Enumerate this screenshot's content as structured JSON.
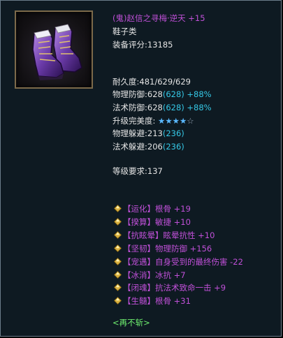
{
  "item": {
    "title": "(鬼)赵信之寻梅·逆天",
    "enhance": "+15",
    "type": "鞋子类",
    "score_label": "装备评分:",
    "score_value": "13185",
    "icon": "purple-boots-icon"
  },
  "stats": {
    "durability": "耐久度:481/629/629",
    "phys_def_label": "物理防御:628",
    "phys_def_extra": "(628) +88%",
    "mag_def_label": "法术防御:628",
    "mag_def_extra": "(628) +88%",
    "upgrade_label": "升级完美度:",
    "upgrade_stars_filled": "★★★★",
    "upgrade_stars_empty": "☆",
    "phys_dodge_label": "物理躲避:213",
    "phys_dodge_extra": "(236)",
    "mag_dodge_label": "法术躲避:206",
    "mag_dodge_extra": "(236)"
  },
  "requirement": "等级要求:137",
  "gems": [
    {
      "tag": "【运化】",
      "text": "根骨 +19"
    },
    {
      "tag": "【揆算】",
      "text": "敏捷 +10"
    },
    {
      "tag": "【抗眩晕】",
      "text": "眩晕抗性 +10"
    },
    {
      "tag": "【坚韧】",
      "text": "物理防御 +156"
    },
    {
      "tag": "【宠遇】",
      "text": "自身受到的最终伤害 -22"
    },
    {
      "tag": "【冰消】",
      "text": "冰抗 +7"
    },
    {
      "tag": "【闭魂】",
      "text": "抗法术致命一击 +9"
    },
    {
      "tag": "【生髓】",
      "text": "根骨 +31"
    }
  ],
  "footer": "<再不斩>",
  "colors": {
    "title": "#c050d8",
    "cyan": "#35c8e6",
    "footer": "#6ff06f",
    "background": "#0e1a22",
    "gem_icon": "#d8b040"
  }
}
